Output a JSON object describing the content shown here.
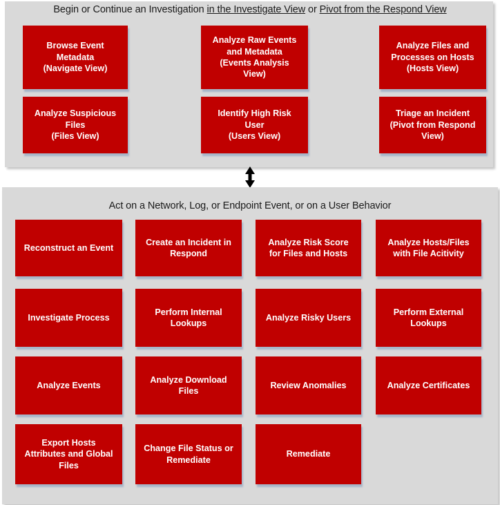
{
  "colors": {
    "node_fill": "#C00000",
    "node_text": "#FFFFFF",
    "panel_bg": "#D9D9D9",
    "page_bg": "#FFFFFF",
    "heading_text": "#1A1A1A",
    "arrow": "#000000"
  },
  "top_panel": {
    "heading": {
      "parts": [
        {
          "text": "Begin or Continue an Investigation ",
          "underline": false
        },
        {
          "text": "in the Investigate View",
          "underline": true
        },
        {
          "text": " or ",
          "underline": false
        },
        {
          "text": "Pivot from the Respond View",
          "underline": true
        }
      ],
      "plain": "Begin or Continue an Investigation in the Investigate View or Pivot from the Respond View"
    },
    "nodes": [
      {
        "id": "browse-event-metadata",
        "lines": [
          "Browse Event",
          "Metadata",
          "(Navigate View)"
        ]
      },
      {
        "id": "analyze-raw-events-and-metadata",
        "lines": [
          "Analyze Raw Events",
          "and Metadata",
          "(Events Analysis",
          "View)"
        ]
      },
      {
        "id": "analyze-files-and-processes-on-hosts",
        "lines": [
          "Analyze Files and",
          "Processes on Hosts",
          "(Hosts View)"
        ]
      },
      {
        "id": "analyze-suspicious-files",
        "lines": [
          "Analyze Suspicious",
          "Files",
          "(Files View)"
        ]
      },
      {
        "id": "identify-high-risk-user",
        "lines": [
          "Identify High Risk",
          "User",
          "(Users View)"
        ]
      },
      {
        "id": "triage-an-incident",
        "lines": [
          "Triage an Incident",
          "(Pivot from Respond",
          "View)"
        ]
      }
    ]
  },
  "connector": {
    "icon": "double-headed-vertical-arrow"
  },
  "bottom_panel": {
    "heading": {
      "parts": [
        {
          "text": "Act on a Network, Log, or Endpoint Event, or on a User Behavior",
          "underline": false
        }
      ],
      "plain": "Act on a Network, Log, or Endpoint Event, or on a User Behavior"
    },
    "nodes": [
      {
        "id": "reconstruct-an-event",
        "lines": [
          "Reconstruct an Event"
        ]
      },
      {
        "id": "create-an-incident-in-respond",
        "lines": [
          "Create an Incident in",
          "Respond"
        ]
      },
      {
        "id": "analyze-risk-score-for-files-and-hosts",
        "lines": [
          "Analyze Risk Score",
          "for Files and Hosts"
        ]
      },
      {
        "id": "analyze-hosts-files-with-file-activity",
        "lines": [
          "Analyze Hosts/Files",
          "with File Acitivity"
        ]
      },
      {
        "id": "investigate-process",
        "lines": [
          "Investigate Process"
        ]
      },
      {
        "id": "perform-internal-lookups",
        "lines": [
          "Perform Internal",
          "Lookups"
        ]
      },
      {
        "id": "analyze-risky-users",
        "lines": [
          "Analyze Risky Users"
        ]
      },
      {
        "id": "perform-external-lookups",
        "lines": [
          "Perform External",
          "Lookups"
        ]
      },
      {
        "id": "analyze-events",
        "lines": [
          "Analyze Events"
        ]
      },
      {
        "id": "analyze-download-files",
        "lines": [
          "Analyze Download",
          "Files"
        ]
      },
      {
        "id": "review-anomalies",
        "lines": [
          "Review Anomalies"
        ]
      },
      {
        "id": "analyze-certificates",
        "lines": [
          "Analyze Certificates"
        ]
      },
      {
        "id": "export-hosts-attributes-and-global-files",
        "lines": [
          "Export Hosts",
          "Attributes and Global",
          "Files"
        ]
      },
      {
        "id": "change-file-status-or-remediate",
        "lines": [
          "Change File Status or",
          "Remediate"
        ]
      },
      {
        "id": "remediate",
        "lines": [
          "Remediate"
        ]
      }
    ]
  }
}
